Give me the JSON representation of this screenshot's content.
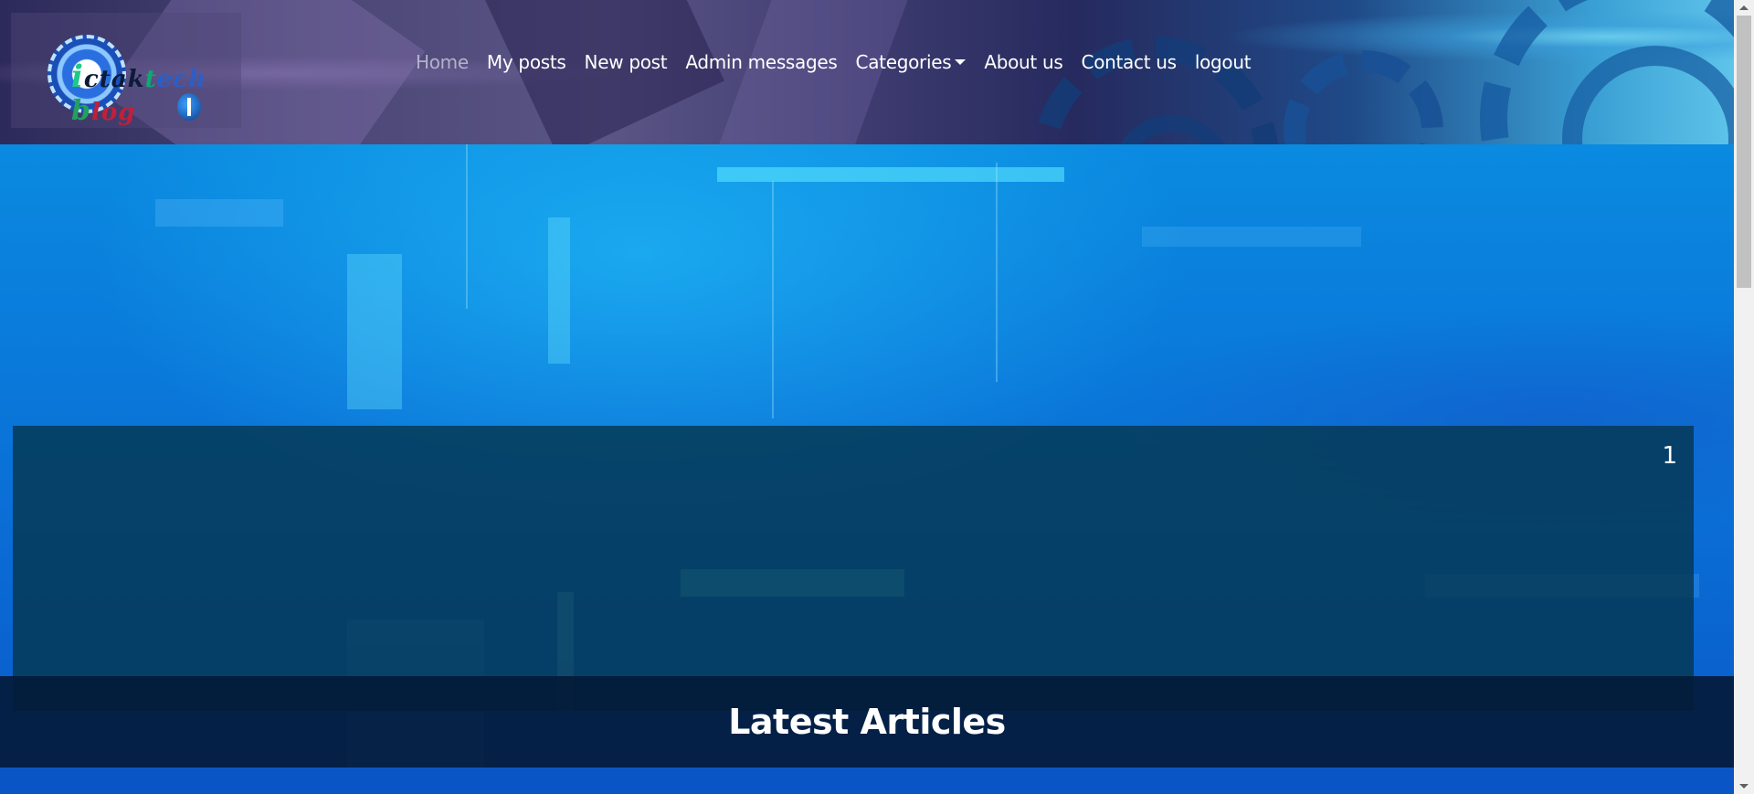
{
  "header": {
    "logo": {
      "letters": [
        "i",
        "ctak",
        "t",
        "ech ",
        "b",
        "log"
      ],
      "alt": "ictaktech blog"
    },
    "nav": [
      {
        "label": "Home",
        "active": true
      },
      {
        "label": "My posts"
      },
      {
        "label": "New post"
      },
      {
        "label": "Admin messages"
      },
      {
        "label": "Categories",
        "dropdown": true
      },
      {
        "label": "About us"
      },
      {
        "label": "Contact us"
      },
      {
        "label": "logout"
      }
    ]
  },
  "hero": {
    "slide_number": "1"
  },
  "latest": {
    "title": "Latest Articles"
  },
  "colors": {
    "nav_text": "#ffffff",
    "nav_active": "#9a9ab0",
    "hero_card": "#053750",
    "band": "#03193a"
  }
}
